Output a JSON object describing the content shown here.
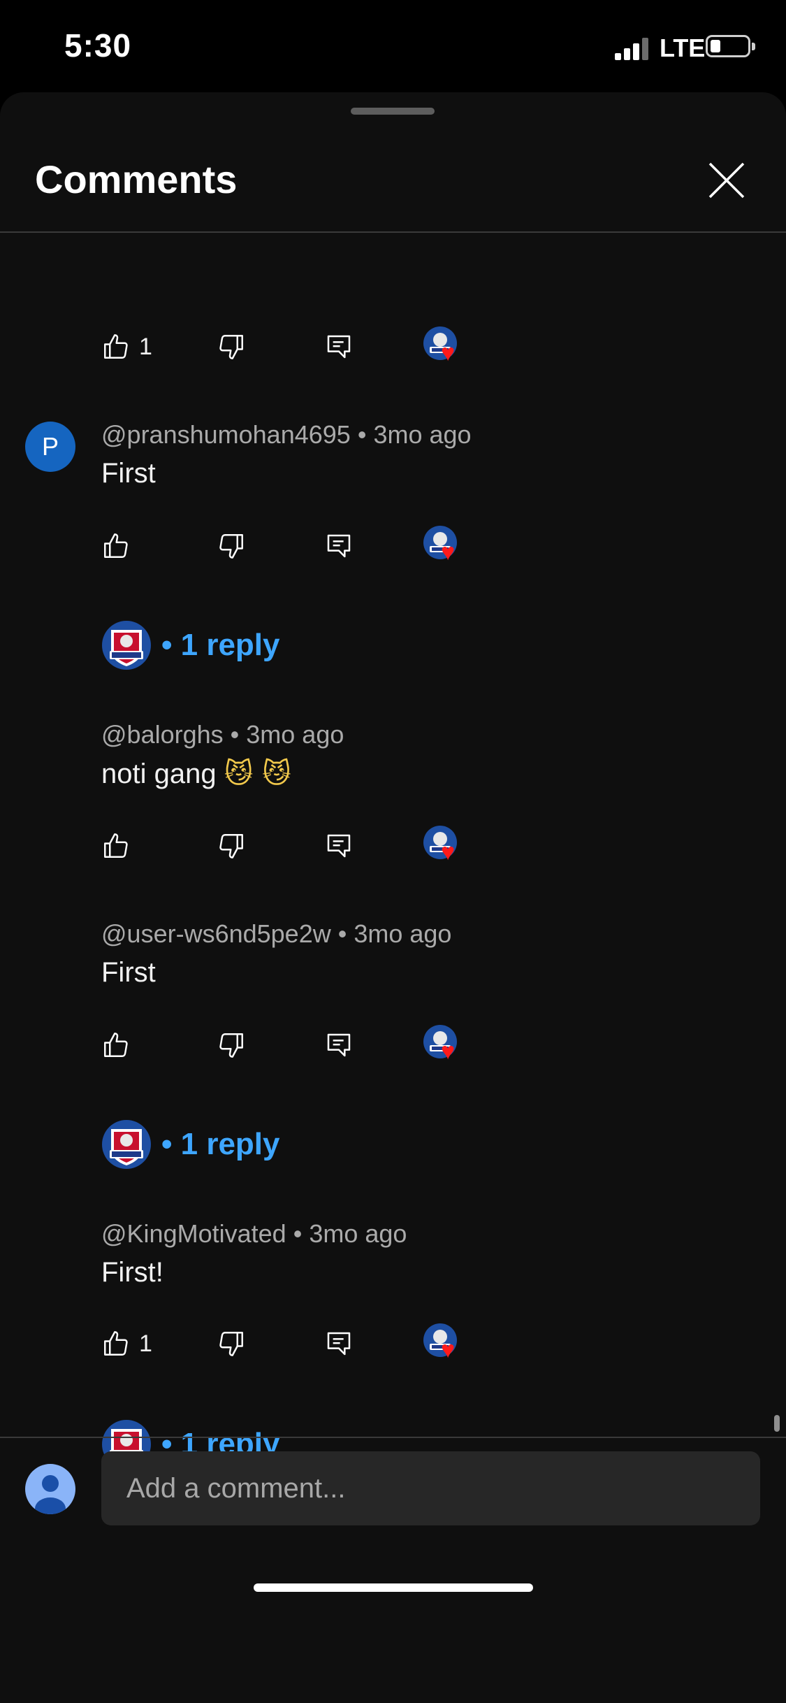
{
  "status_bar": {
    "time": "5:30",
    "network": "LTE"
  },
  "sheet": {
    "title": "Comments"
  },
  "top_partial": {
    "like_count": "1"
  },
  "comments": [
    {
      "handle": "@pranshumohan4695",
      "age": "3mo ago",
      "text": "First",
      "like_count": "",
      "avatar_letter": "P",
      "reply_label": "• 1 reply"
    },
    {
      "handle": "@balorghs",
      "age": "3mo ago",
      "text": "noti gang",
      "emoji": "😼 😼",
      "like_count": "",
      "reply_label": ""
    },
    {
      "handle": "@user-ws6nd5pe2w",
      "age": "3mo ago",
      "text": "First",
      "like_count": "",
      "reply_label": "• 1 reply"
    },
    {
      "handle": "@KingMotivated",
      "age": "3mo ago",
      "text": "First!",
      "like_count": "1",
      "reply_label": "• 1 reply"
    }
  ],
  "composer": {
    "placeholder": "Add a comment..."
  },
  "colors": {
    "accent": "#3ea6ff",
    "heart": "#ff1a1a",
    "background": "#0f0f0f"
  }
}
